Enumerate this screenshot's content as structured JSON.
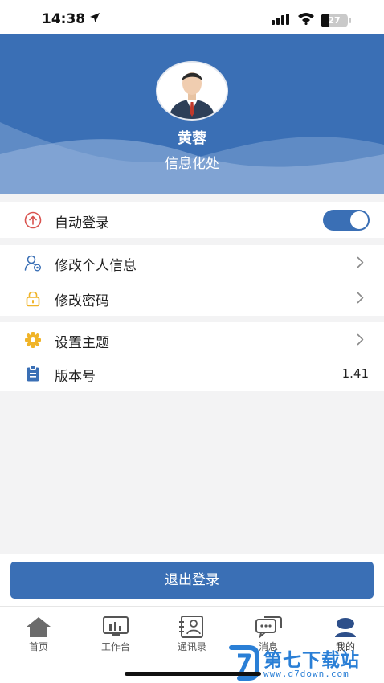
{
  "status": {
    "time": "14:38",
    "battery": "27"
  },
  "profile": {
    "name": "黄蓉",
    "department": "信息化处"
  },
  "settings": {
    "auto_login": {
      "label": "自动登录",
      "enabled": true
    },
    "edit_profile": {
      "label": "修改个人信息"
    },
    "change_password": {
      "label": "修改密码"
    },
    "theme": {
      "label": "设置主题"
    },
    "version": {
      "label": "版本号",
      "value": "1.41"
    }
  },
  "logout_label": "退出登录",
  "tabs": [
    {
      "label": "首页",
      "icon": "home-icon"
    },
    {
      "label": "工作台",
      "icon": "workbench-icon"
    },
    {
      "label": "通讯录",
      "icon": "contacts-icon"
    },
    {
      "label": "消息",
      "icon": "message-icon"
    },
    {
      "label": "我的",
      "icon": "profile-icon",
      "active": true
    }
  ],
  "watermark": {
    "brand": "第七下载站",
    "url": "www.d7down.com"
  },
  "colors": {
    "primary": "#3a6fb5",
    "background": "#f3f3f4",
    "watermark": "#2a7fd6"
  }
}
